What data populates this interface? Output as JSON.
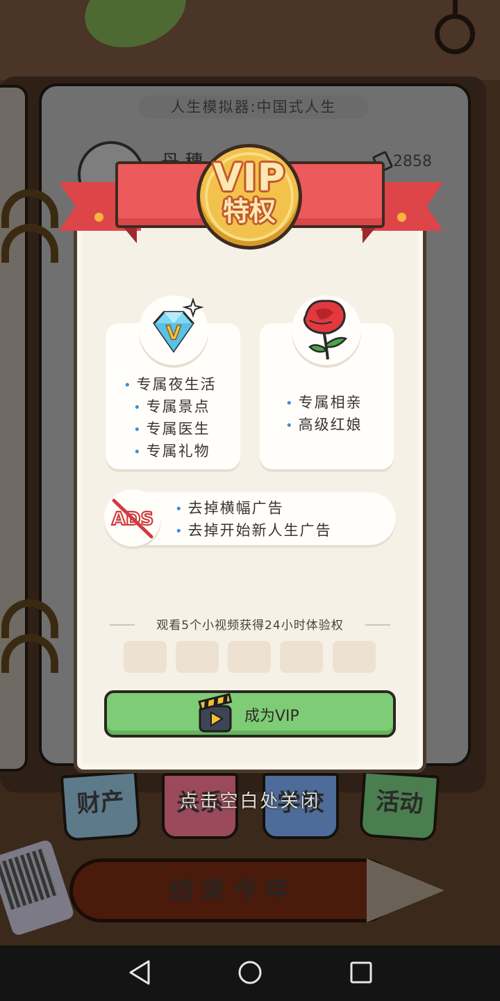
{
  "background": {
    "page_title": "人生模拟器:中国式人生",
    "player_name": "丹 穗",
    "money": "2858",
    "tabs": [
      "财产",
      "关系",
      "学校",
      "活动"
    ],
    "end_year_label": "结束今年"
  },
  "modal": {
    "badge_title": "VIP",
    "badge_subtitle": "特权",
    "card_left_items": [
      "专属夜生活",
      "专属景点",
      "专属医生",
      "专属礼物"
    ],
    "card_right_items": [
      "专属相亲",
      "高级红娘"
    ],
    "ads_items": [
      "去掉横幅广告",
      "去掉开始新人生广告"
    ],
    "ads_icon_text": "ADS",
    "diamond_letter": "V",
    "trial_text": "观看5个小视频获得24小时体验权",
    "trial_progress": {
      "watched": 0,
      "total": 5
    },
    "cta_label": "成为VIP"
  },
  "close_hint": "点击空白处关闭",
  "icons": {
    "diamond": "diamond-v-icon",
    "rose": "rose-icon",
    "no_ads": "no-ads-icon",
    "video": "clapperboard-icon"
  },
  "colors": {
    "ribbon": "#ec5a5c",
    "coin": "#f2c24d",
    "cta": "#7fcc76",
    "bullet": "#3b8fe0"
  }
}
